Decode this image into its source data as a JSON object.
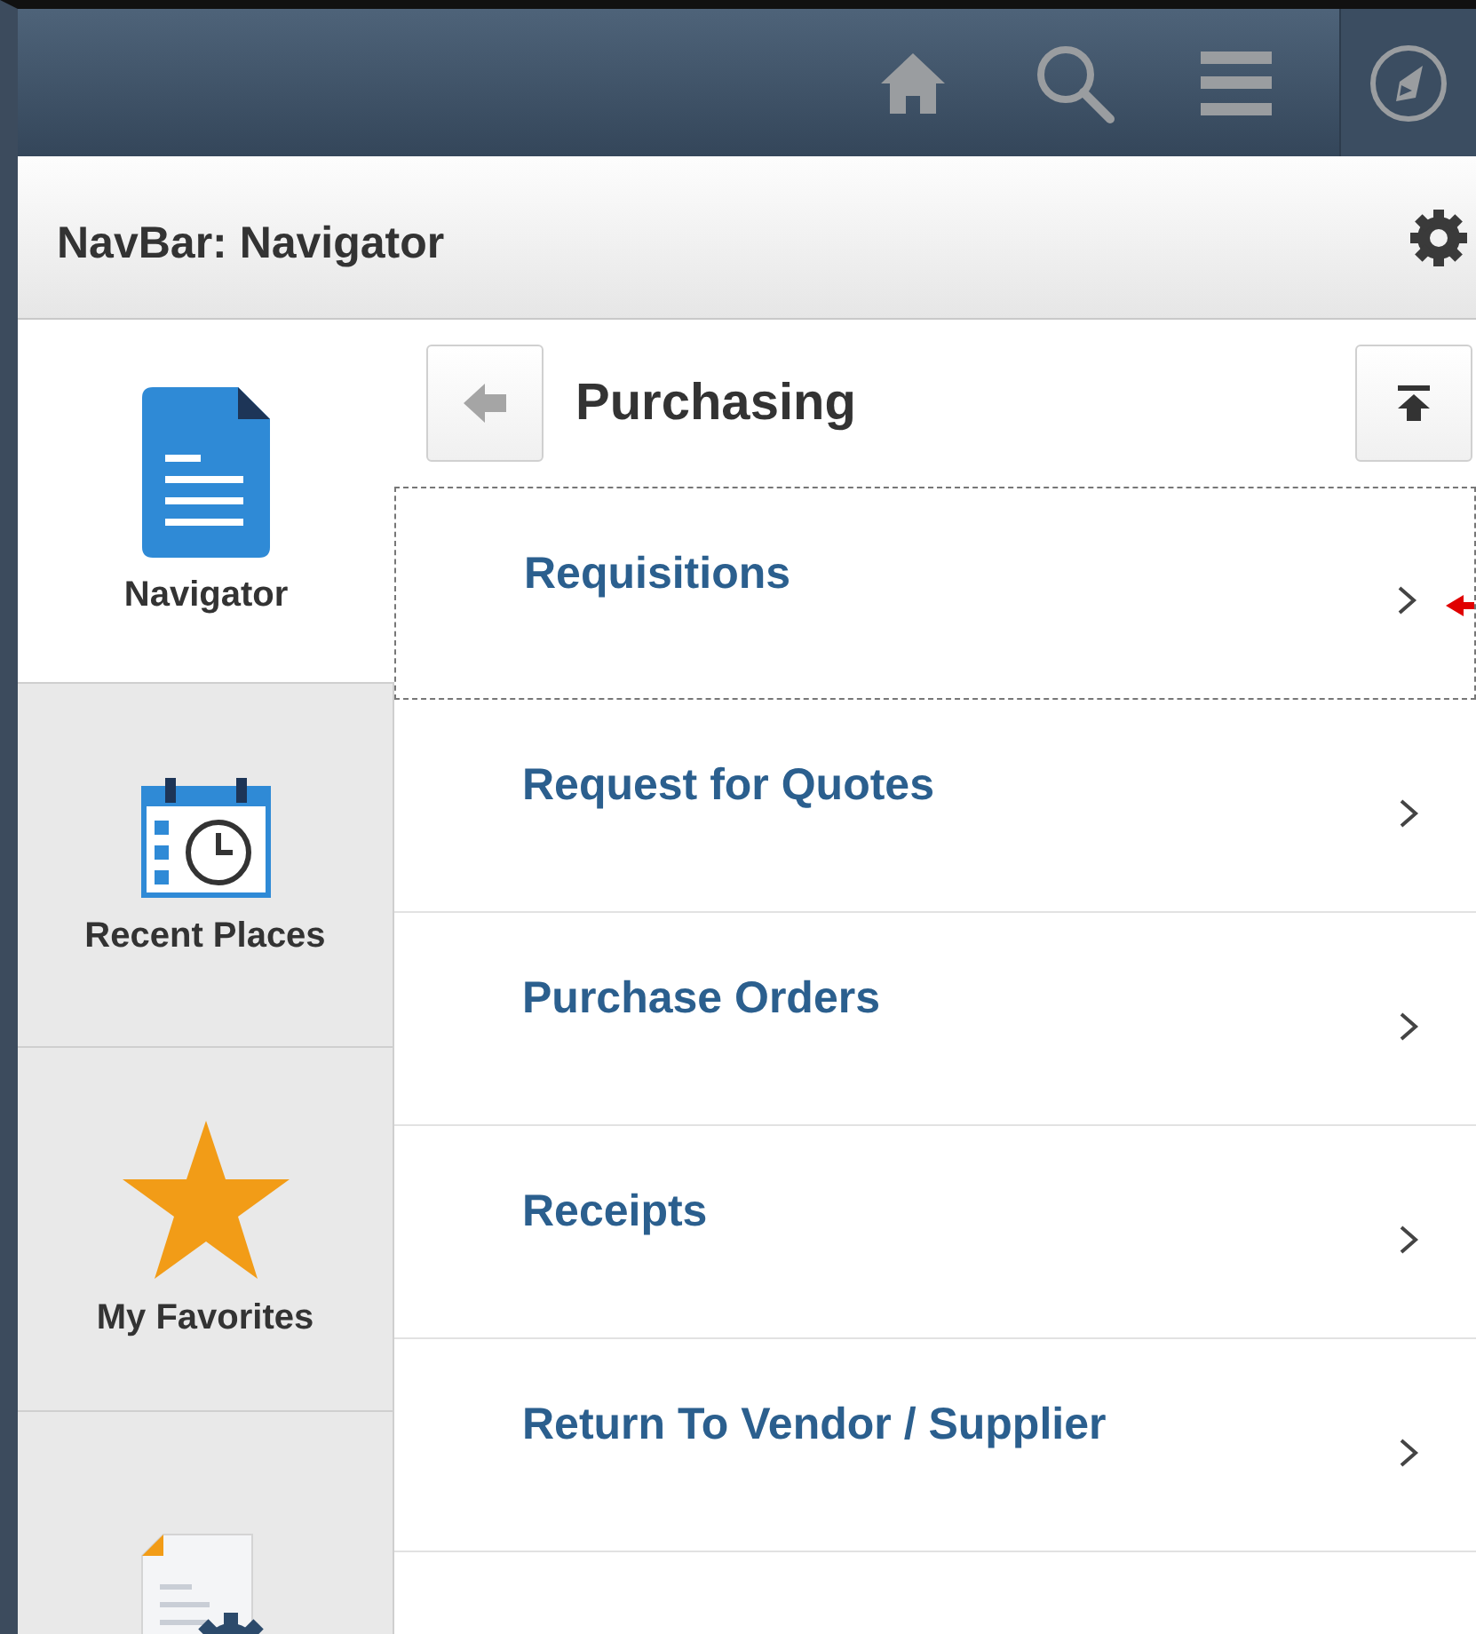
{
  "header": {
    "icons": [
      {
        "kind": "home"
      },
      {
        "kind": "search"
      },
      {
        "kind": "menu"
      },
      {
        "kind": "compass"
      }
    ]
  },
  "title_bar": {
    "title": "NavBar: Navigator"
  },
  "sidebar": {
    "items": [
      {
        "kind": "document",
        "label": "Navigator",
        "selected": true
      },
      {
        "kind": "calendar",
        "label": "Recent Places",
        "selected": false
      },
      {
        "kind": "star",
        "label": "My Favorites",
        "selected": false
      },
      {
        "kind": "document-gear",
        "selected": false
      }
    ]
  },
  "panel": {
    "title": "Purchasing",
    "items": [
      {
        "label": "Requisitions",
        "selected": true
      },
      {
        "label": "Request for Quotes",
        "selected": false
      },
      {
        "label": "Purchase Orders",
        "selected": false
      },
      {
        "label": "Receipts",
        "selected": false
      },
      {
        "label": "Return To Vendor / Supplier",
        "selected": false
      }
    ]
  }
}
